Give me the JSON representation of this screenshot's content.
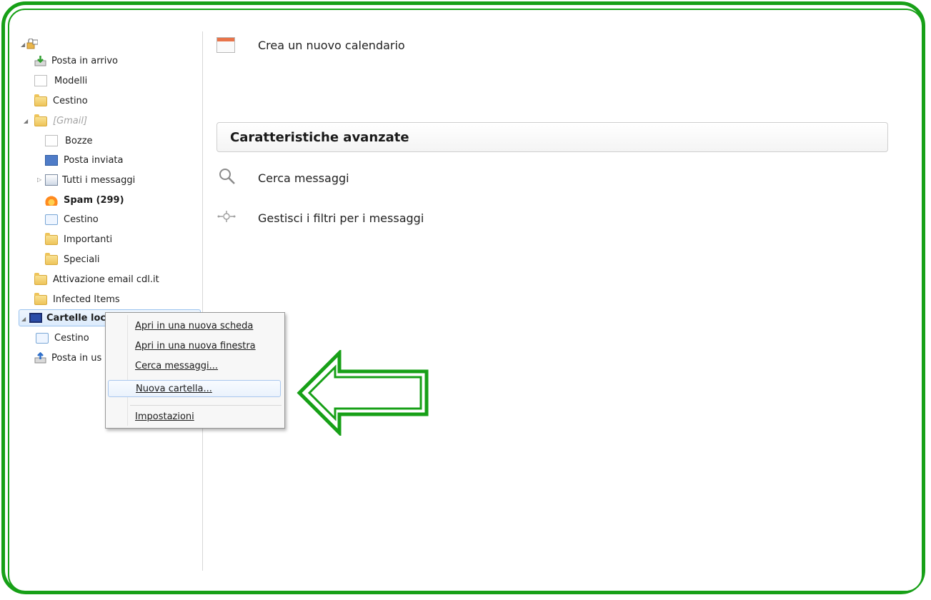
{
  "folder_tree": {
    "items": [
      {
        "label": "",
        "style": "normal"
      },
      {
        "label": "Posta in arrivo",
        "style": "normal"
      },
      {
        "label": "Modelli",
        "style": "normal"
      },
      {
        "label": "Cestino",
        "style": "normal"
      },
      {
        "label": "[Gmail]",
        "style": "italic"
      },
      {
        "label": "Bozze",
        "style": "normal"
      },
      {
        "label": "Posta inviata",
        "style": "normal"
      },
      {
        "label": "Tutti i messaggi",
        "style": "normal"
      },
      {
        "label": "Spam (299)",
        "style": "bold"
      },
      {
        "label": "Cestino",
        "style": "normal"
      },
      {
        "label": "Importanti",
        "style": "normal"
      },
      {
        "label": "Speciali",
        "style": "normal"
      },
      {
        "label": "Attivazione email cdl.it",
        "style": "normal"
      },
      {
        "label": "Infected Items",
        "style": "normal"
      },
      {
        "label": "Cartelle loca",
        "style": "bold"
      },
      {
        "label": "Cestino",
        "style": "normal"
      },
      {
        "label": "Posta in us",
        "style": "normal"
      }
    ]
  },
  "main": {
    "create_calendar": "Crea un nuovo calendario",
    "advanced_section_title": "Caratteristiche avanzate",
    "search_messages": "Cerca messaggi",
    "manage_filters": "Gestisci i filtri per i messaggi"
  },
  "context_menu": {
    "items": [
      "Apri in una nuova scheda",
      "Apri in una nuova finestra",
      "Cerca messaggi...",
      "Nuova cartella...",
      "Impostazioni"
    ]
  },
  "colors": {
    "frame_green": "#17a017",
    "selection_blue": "#dcebfc"
  }
}
